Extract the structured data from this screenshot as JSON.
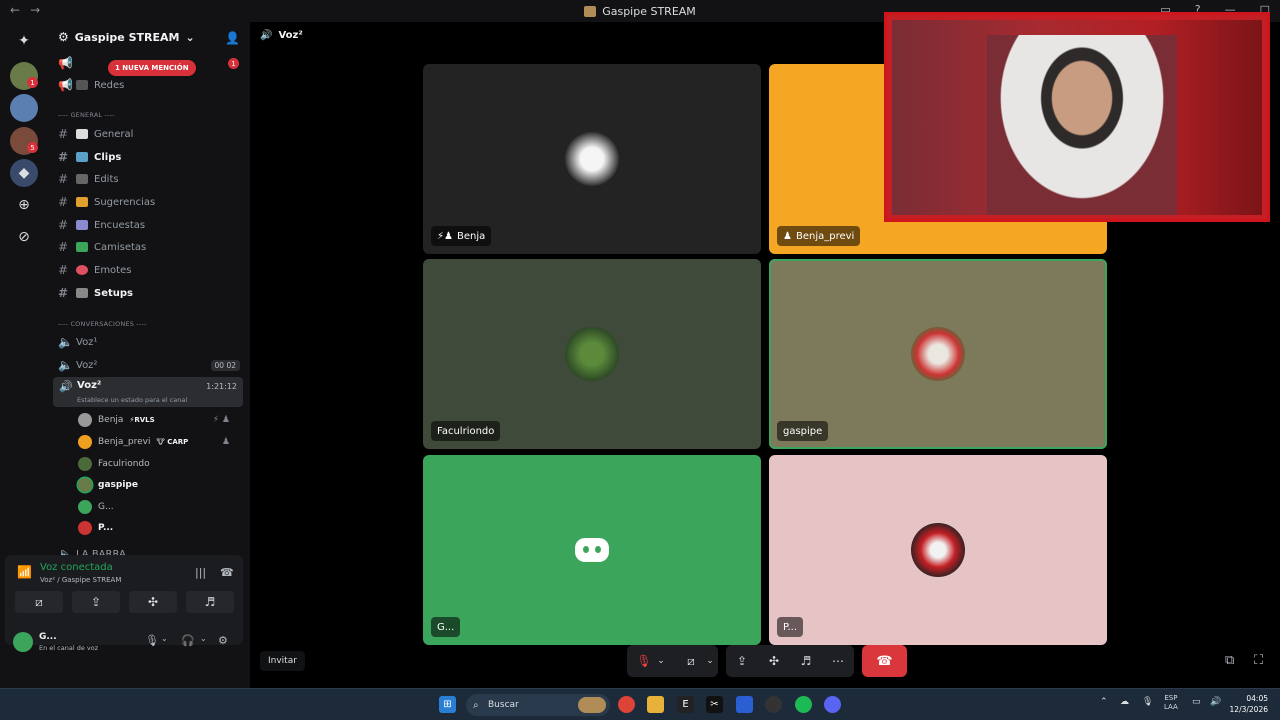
{
  "window": {
    "title": "Gaspipe STREAM"
  },
  "server": {
    "name": "Gaspipe STREAM"
  },
  "sidebar": {
    "mention_label": "1 NUEVA MENCIÓN",
    "mention_count": "1",
    "redes": "Redes",
    "cat_general": "---- GENERAL ----",
    "channels": [
      "General",
      "Clips",
      "Edits",
      "Sugerencias",
      "Encuestas",
      "Camisetas",
      "Emotes",
      "Setups"
    ],
    "cat_conv": "---- CONVERSACIONES ----",
    "voice": [
      {
        "label": "Voz¹",
        "extra": ""
      },
      {
        "label": "Voz²",
        "extra": "00  02"
      },
      {
        "label": "Voz²",
        "extra": "1:21:12"
      }
    ],
    "status_prompt": "Establece un estado para el canal",
    "voice_users": [
      {
        "name": "Benja",
        "tag": "⚡RVLS"
      },
      {
        "name": "Benja_previ",
        "tag": "🐮 CARP"
      },
      {
        "name": "Faculriondo",
        "tag": ""
      },
      {
        "name": "gaspipe",
        "tag": ""
      },
      {
        "name": "G...",
        "tag": ""
      },
      {
        "name": "P...",
        "tag": ""
      }
    ],
    "la_barra": "LA BARRA"
  },
  "connection": {
    "title": "Voz conectada",
    "subtitle": "Voz² / Gaspipe STREAM"
  },
  "user": {
    "name": "G...",
    "status": "En el canal de voz"
  },
  "main": {
    "channel_title": "Voz²",
    "tiles": [
      "Benja",
      "Benja_previ",
      "Faculriondo",
      "gaspipe",
      "G...",
      "P..."
    ],
    "invite": "Invitar"
  },
  "taskbar": {
    "search": "Buscar",
    "lang_top": "ESP",
    "lang_bottom": "LAA",
    "time": "04:05",
    "date": "12/3/2026"
  }
}
